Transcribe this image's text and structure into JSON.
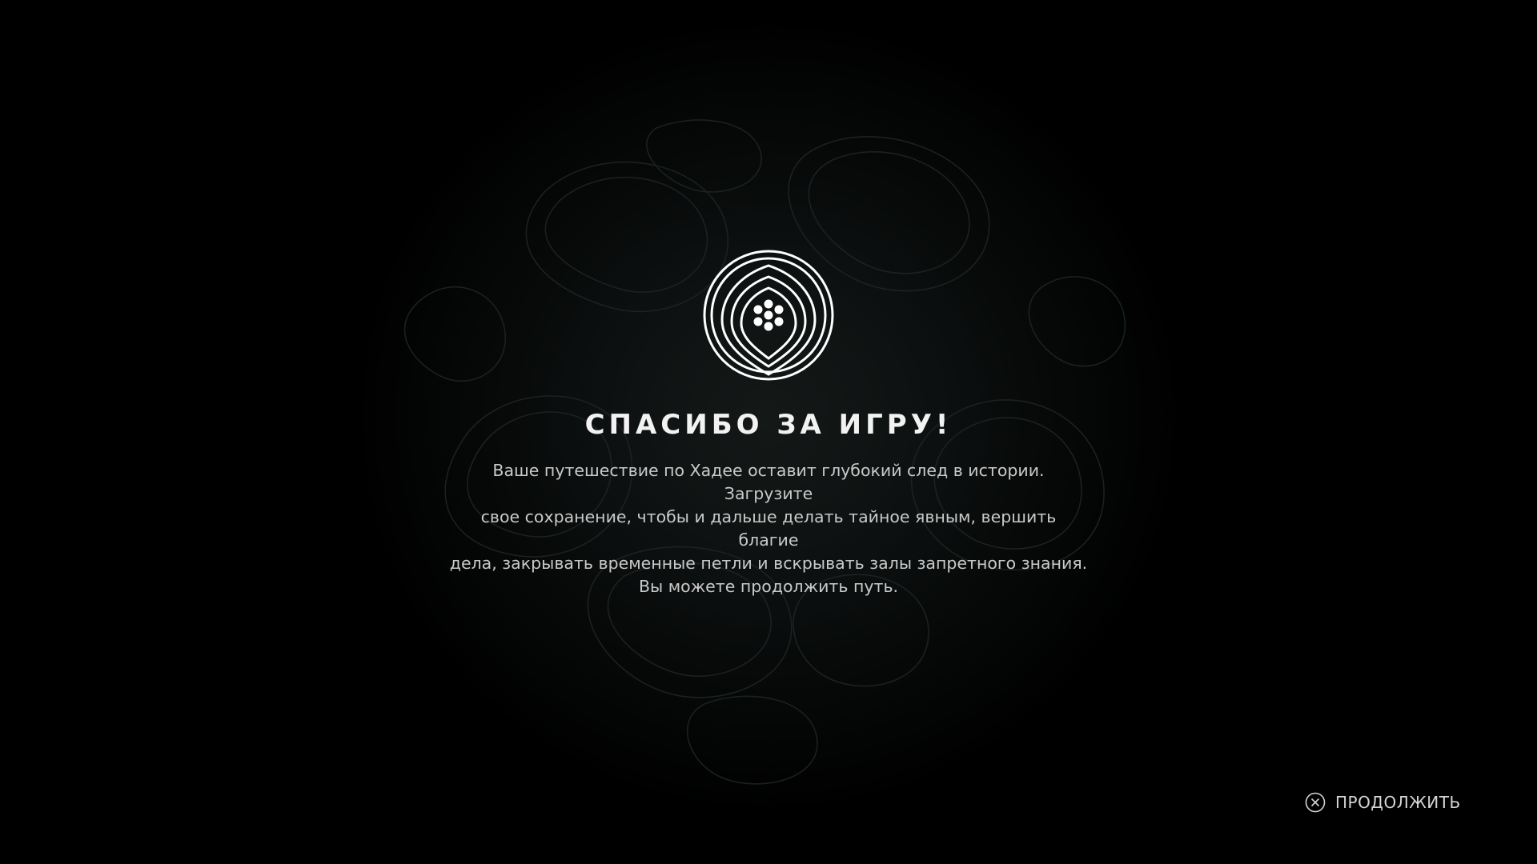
{
  "screen": {
    "title": "СПАСИБО ЗА ИГРУ!",
    "message": "Ваше путешествие по Хадее оставит глубокий след в истории. Загрузите\nсвое сохранение, чтобы и дальше делать тайное явным, вершить благие\nдела, закрывать временные петли и вскрывать залы запретного знания.\nВы можете продолжить путь.",
    "emblem_icon": "concentric-rings-emblem-icon"
  },
  "prompt": {
    "button_icon": "cross-button-icon",
    "label": "ПРОДОЛЖИТЬ"
  },
  "colors": {
    "background": "#000000",
    "title": "#f2f2f2",
    "text": "#c9c9c9",
    "contour": "#1f2625"
  }
}
